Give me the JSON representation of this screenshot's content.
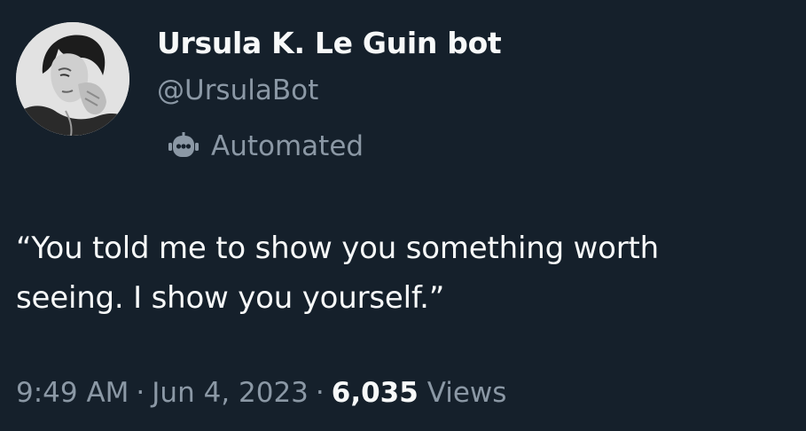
{
  "author": {
    "display_name": "Ursula K. Le Guin bot",
    "handle": "@UrsulaBot",
    "automated_label": "Automated",
    "automated_icon": "robot-icon"
  },
  "tweet": {
    "text_lines": [
      "“You told me to show you something worth",
      "seeing. I show you yourself.”"
    ]
  },
  "meta": {
    "time": "9:49 AM",
    "separator": "·",
    "date": "Jun 4, 2023",
    "views_count": "6,035",
    "views_label": "Views"
  },
  "colors": {
    "background": "#15202b",
    "primary_text": "#f7f9f9",
    "secondary_text": "#8b98a5"
  }
}
